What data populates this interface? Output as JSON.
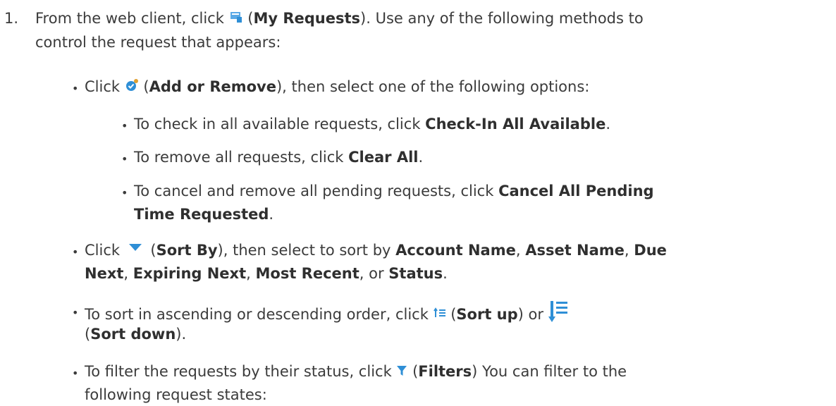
{
  "step": {
    "number": "1.",
    "text_a": "From the web client, click ",
    "icon": "my-requests-icon",
    "text_b": " (",
    "bold": "My Requests",
    "text_c": "). Use any of the following methods to",
    "line2": "control the request that appears:"
  },
  "bullets": {
    "add_remove": {
      "text_a": "Click ",
      "icon": "add-remove-icon",
      "text_b": " (",
      "bold": "Add or Remove",
      "text_c": "), then select one of the following options:",
      "options": [
        {
          "text": "To check in all available requests, click ",
          "bold": "Check-In All Available",
          "end": "."
        },
        {
          "text": "To remove all requests, click ",
          "bold": "Clear All",
          "end": "."
        },
        {
          "text": "To cancel and remove all pending requests, click ",
          "bold": "Cancel All Pending",
          "bold2": "Time Requested",
          "end": "."
        }
      ]
    },
    "sort_by": {
      "text_a": "Click ",
      "icon": "sort-by-icon",
      "text_b": " (",
      "bold": "Sort By",
      "text_c": "), then select to sort by ",
      "opt1": "Account Name",
      "sep": ", ",
      "opt2": "Asset Name",
      "opt3a": "Due",
      "opt3b": "Next",
      "opt4": "Expiring Next",
      "opt5": "Most Recent",
      "or": ", or ",
      "opt6": "Status",
      "end": "."
    },
    "sort_order": {
      "text_a": "To sort in ascending or descending order, click ",
      "icon_up": "sort-up-icon",
      "text_b": " (",
      "bold_up": "Sort up",
      "text_c": ") or ",
      "icon_down": "sort-down-icon",
      "text_d": "(",
      "bold_down": "Sort down",
      "text_e": ")."
    },
    "filters": {
      "text_a": "To filter the requests by their status, click ",
      "icon": "filter-icon",
      "text_b": " (",
      "bold": "Filters",
      "text_c": ") You can filter to the",
      "line2": "following request states:"
    }
  },
  "colors": {
    "text": "#3b3b3b",
    "icon_blue": "#2f8fd6"
  }
}
